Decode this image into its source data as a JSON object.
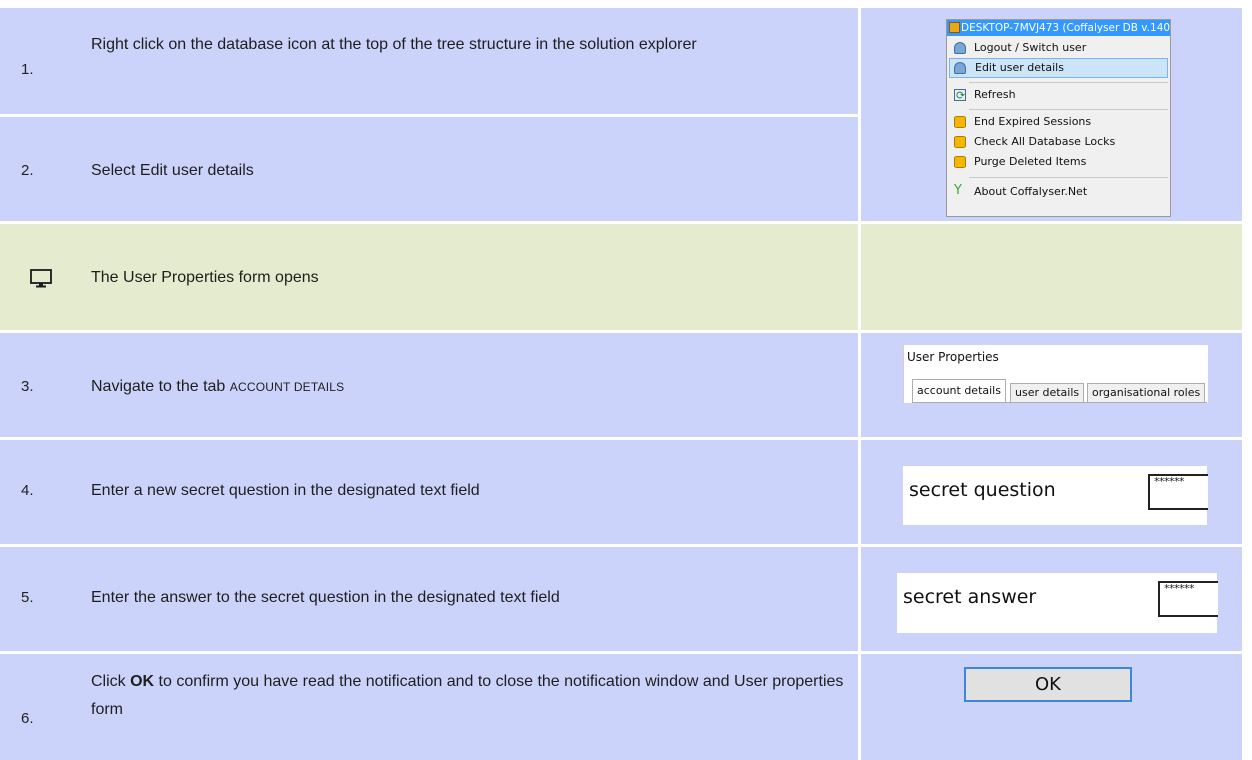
{
  "steps": [
    {
      "number": "1.",
      "text": "Right click on the database icon at the top of the tree structure in the solution explorer"
    },
    {
      "number": "2.",
      "text": "Select Edit user details"
    },
    {
      "text": "The User Properties form opens",
      "icon": "monitor-icon"
    },
    {
      "number": "3.",
      "text_before": "Navigate to the tab ",
      "text_caps": "ACCOUNT DETAILS"
    },
    {
      "number": "4.",
      "text": "Enter a new secret question in the designated text field"
    },
    {
      "number": "5.",
      "text": "Enter the answer to the secret question in the designated text field"
    },
    {
      "number": "6.",
      "text_before": "Click ",
      "text_bold": "OK",
      "text_after": " to confirm you have read the notification and to close the notification window and User properties form"
    }
  ],
  "context_menu": {
    "title": "DESKTOP-7MVJ473 (Coffalyser DB v.140",
    "items": [
      {
        "label": "Logout / Switch user",
        "icon": "user-icon"
      },
      {
        "label": "Edit user details",
        "icon": "user-icon",
        "selected": true
      },
      {
        "label": "Refresh",
        "icon": "refresh-icon"
      },
      {
        "label": "End Expired Sessions",
        "icon": "database-icon"
      },
      {
        "label": "Check All Database Locks",
        "icon": "database-icon"
      },
      {
        "label": "Purge Deleted Items",
        "icon": "database-icon"
      },
      {
        "label": "About Coffalyser.Net",
        "icon": "coffalyser-logo-icon"
      }
    ]
  },
  "user_properties": {
    "title": "User Properties",
    "tabs": [
      "account details",
      "user details",
      "organisational roles"
    ]
  },
  "secret_question": {
    "label": "secret question",
    "value": "******"
  },
  "secret_answer": {
    "label": "secret answer",
    "value": "******"
  },
  "ok_button": {
    "label": "OK"
  },
  "colors": {
    "step_row": "#ccd3fb",
    "info_row": "#e5ebce",
    "menu_highlight": "#3399ff",
    "button_border": "#3f86d6"
  }
}
